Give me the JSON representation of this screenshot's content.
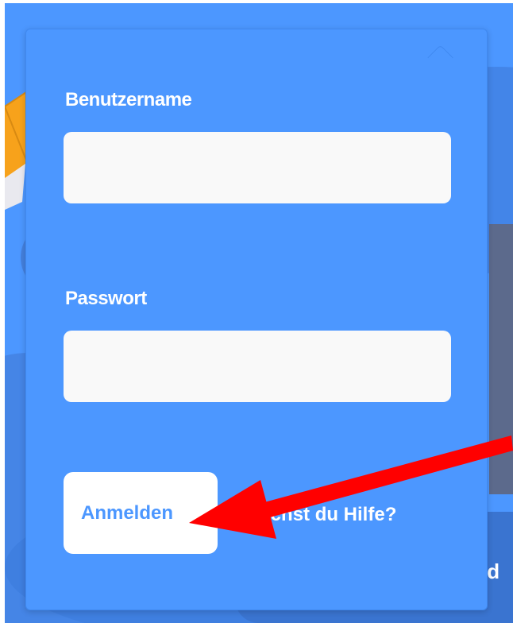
{
  "login_form": {
    "username_label": "Benutzername",
    "username_value": "",
    "password_label": "Passwort",
    "password_value": "",
    "login_button_label": "Anmelden",
    "help_link_label": "Brauchst du Hilfe?"
  },
  "background": {
    "partial_text": "id"
  },
  "annotation": {
    "type": "arrow",
    "color": "#ff0000",
    "target": "login-button"
  },
  "colors": {
    "panel": "#4c97ff",
    "input": "#f9f9f9",
    "button_text": "#4c97ff",
    "arrow": "#ff0000"
  }
}
